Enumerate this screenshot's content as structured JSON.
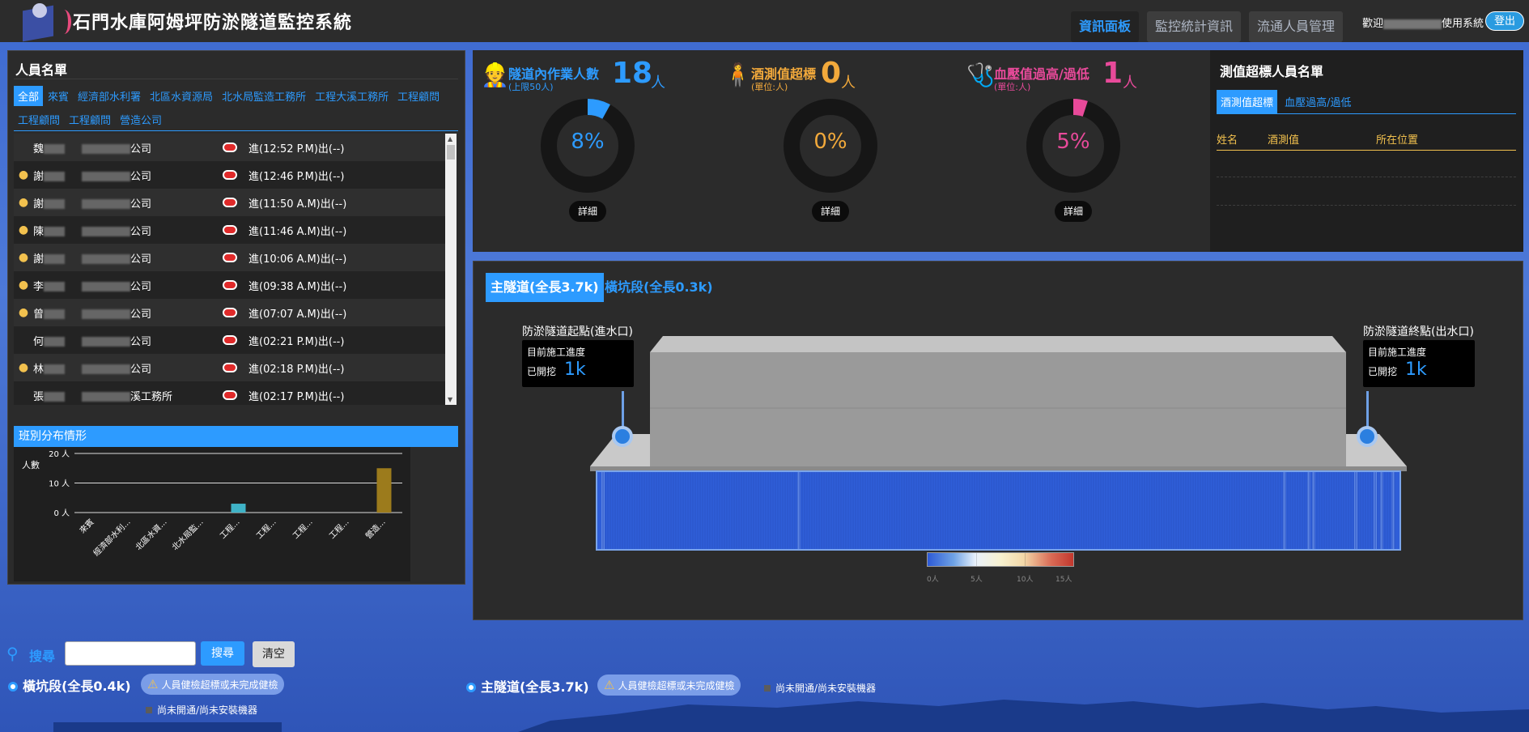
{
  "header": {
    "title": "石門水庫阿姆坪防淤隧道監控系統",
    "nav": [
      "資訊面板",
      "監控統計資訊",
      "流通人員管理"
    ],
    "active_nav": 0,
    "welcome_prefix": "歡迎",
    "welcome_suffix": "使用系統",
    "logout": "登出"
  },
  "people": {
    "title": "人員名單",
    "tabs": [
      "全部",
      "來賓",
      "經濟部水利署",
      "北區水資源局",
      "北水局監造工務所",
      "工程大溪工務所",
      "工程顧問",
      "工程顧問",
      "工程顧問",
      "營造公司"
    ],
    "rows": [
      {
        "name": "魏",
        "company": "公司",
        "status": "進(12:52 P.M)出(--)",
        "badge": false
      },
      {
        "name": "謝",
        "company": "公司",
        "status": "進(12:46 P.M)出(--)",
        "badge": true
      },
      {
        "name": "謝",
        "company": "公司",
        "status": "進(11:50 A.M)出(--)",
        "badge": true
      },
      {
        "name": "陳",
        "company": "公司",
        "status": "進(11:46 A.M)出(--)",
        "badge": true
      },
      {
        "name": "謝",
        "company": "公司",
        "status": "進(10:06 A.M)出(--)",
        "badge": true
      },
      {
        "name": "李",
        "company": "公司",
        "status": "進(09:38 A.M)出(--)",
        "badge": true
      },
      {
        "name": "曾",
        "company": "公司",
        "status": "進(07:07 A.M)出(--)",
        "badge": true
      },
      {
        "name": "何",
        "company": "公司",
        "status": "進(02:21 P.M)出(--)",
        "badge": false
      },
      {
        "name": "林",
        "company": "公司",
        "status": "進(02:18 P.M)出(--)",
        "badge": true
      },
      {
        "name": "張",
        "company": "溪工務所",
        "status": "進(02:17 P.M)出(--)",
        "badge": false
      }
    ]
  },
  "shift": {
    "title": "班別分布情形"
  },
  "chart_data": {
    "type": "bar",
    "title": "班別分布情形",
    "ylabel": "人數",
    "ylim": [
      0,
      20
    ],
    "yticks": [
      "0 人",
      "10 人",
      "20 人"
    ],
    "categories": [
      "來賓",
      "經濟部水利...",
      "北區水資...",
      "北水局監...",
      "工程...",
      "工程...",
      "工程...",
      "工程...",
      "營造..."
    ],
    "values": [
      0,
      0,
      0,
      0,
      3,
      0,
      0,
      0,
      15
    ],
    "colors": [
      "#3fb3c7",
      "#3fb3c7",
      "#3fb3c7",
      "#3fb3c7",
      "#3fb3c7",
      "#3fb3c7",
      "#3fb3c7",
      "#3fb3c7",
      "#9c7b1c"
    ],
    "grid": true
  },
  "stats": [
    {
      "label": "隧道內作業人數",
      "sub": "(上限50人)",
      "value": "18",
      "unit": "人",
      "pct": 8,
      "pct_text": "8%",
      "color": "#2d9bff",
      "icon": "worker-icon",
      "icon_glyph": "👷",
      "detail": "詳細"
    },
    {
      "label": "酒測值超標",
      "sub": "(單位:人)",
      "value": "0",
      "unit": "人",
      "pct": 0,
      "pct_text": "0%",
      "color": "#f2a93b",
      "icon": "drunk-icon",
      "icon_glyph": "🧍",
      "detail": "詳細"
    },
    {
      "label": "血壓值過高/過低",
      "sub": "(單位:人)",
      "value": "1",
      "unit": "人",
      "pct": 5,
      "pct_text": "5%",
      "color": "#e84a9a",
      "icon": "blood-pressure-icon",
      "icon_glyph": "🩺",
      "detail": "詳細"
    }
  ],
  "over_limit": {
    "title": "測值超標人員名單",
    "tabs": [
      "酒測值超標",
      "血壓過高/過低"
    ],
    "columns": [
      "姓名",
      "酒測值",
      "所在位置"
    ]
  },
  "tunnel": {
    "tabs": [
      "主隧道(全長3.7k)",
      "橫坑段(全長0.3k)"
    ],
    "start_label": "防淤隧道起點(進水口)",
    "end_label": "防淤隧道終點(出水口)",
    "progress_title": "目前施工進度",
    "progress_prefix": "已開挖",
    "start_value": "1k",
    "end_value": "1k",
    "legend_ticks": [
      "0人",
      "5人",
      "10人",
      "15人"
    ]
  },
  "search": {
    "label": "搜尋",
    "button": "搜尋",
    "clear": "清空",
    "placeholder": ""
  },
  "segments": {
    "side": {
      "label": "橫坑段(全長0.4k)",
      "warn": "人員健檢超標或未完成健檢",
      "na": "尚未開通/尚未安裝機器"
    },
    "main": {
      "label": "主隧道(全長3.7k)",
      "warn": "人員健檢超標或未完成健檢",
      "na": "尚未開通/尚未安裝機器"
    }
  }
}
